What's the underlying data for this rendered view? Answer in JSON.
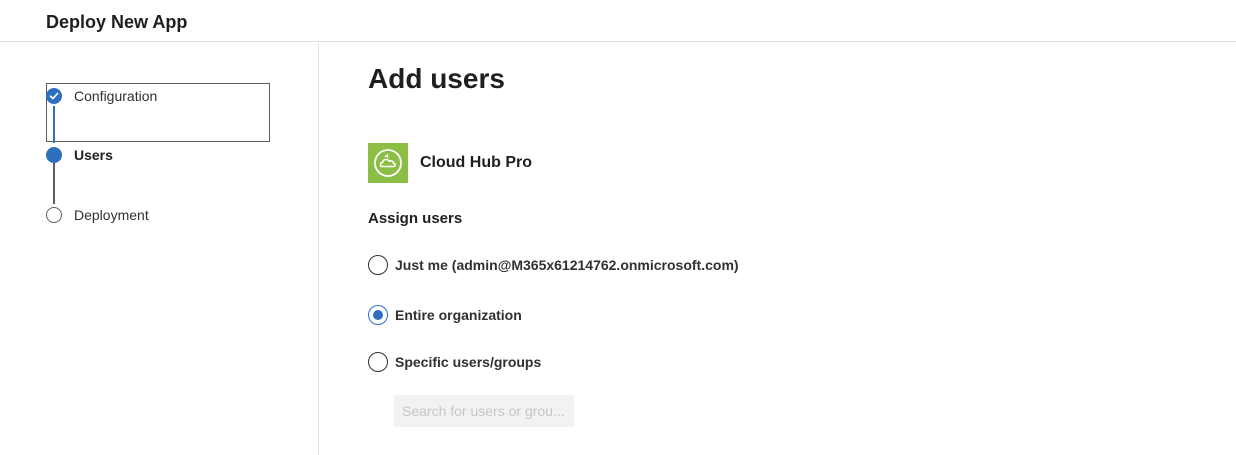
{
  "header": {
    "title": "Deploy New App"
  },
  "steps": [
    {
      "label": "Configuration",
      "state": "done"
    },
    {
      "label": "Users",
      "state": "current"
    },
    {
      "label": "Deployment",
      "state": "todo"
    }
  ],
  "main": {
    "title": "Add users",
    "app": {
      "name": "Cloud Hub Pro",
      "tile_color": "#8cbd45"
    },
    "assign": {
      "title": "Assign users",
      "options": [
        {
          "label": "Just me (admin@M365x61214762.onmicrosoft.com)",
          "checked": false
        },
        {
          "label": "Entire organization",
          "checked": true
        },
        {
          "label": "Specific users/groups",
          "checked": false
        }
      ]
    },
    "search": {
      "placeholder": "Search for users or grou..."
    }
  },
  "colors": {
    "accent": "#2f6fbf",
    "border": "#e1dfdd"
  },
  "icons": {
    "step_done": "checkmark-icon",
    "app": "cloud-sync-icon"
  }
}
